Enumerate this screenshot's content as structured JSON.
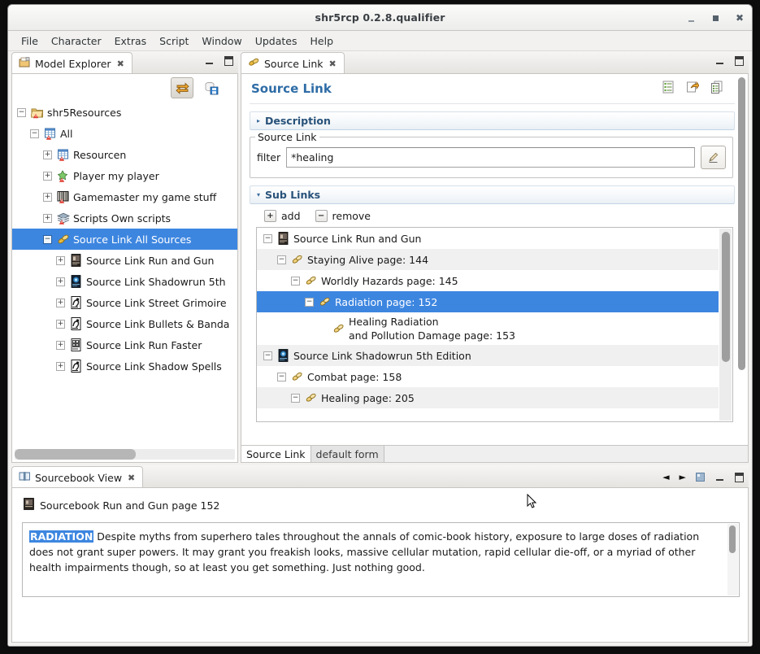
{
  "window": {
    "title": "shr5rcp 0.2.8.qualifier",
    "buttons": {
      "minimize": "minimize-icon",
      "maximize": "maximize-icon",
      "close": "close-icon"
    }
  },
  "menubar": {
    "items": [
      "File",
      "Character",
      "Extras",
      "Script",
      "Window",
      "Updates",
      "Help"
    ]
  },
  "model_explorer": {
    "tab_label": "Model Explorer",
    "tab_close": "✖",
    "toolbar": [
      {
        "name": "link-with-editor-icon",
        "pressed": true
      },
      {
        "name": "save-collapse-icon",
        "pressed": false
      }
    ],
    "tree": [
      {
        "label": "shr5Resources",
        "depth": 0,
        "expander": "−",
        "icon": "folder-warning-icon",
        "selected": false
      },
      {
        "label": "All",
        "depth": 1,
        "expander": "−",
        "icon": "table-warning-icon",
        "selected": false
      },
      {
        "label": "Resourcen",
        "depth": 2,
        "expander": "+",
        "icon": "table-warning-icon",
        "selected": false
      },
      {
        "label": "Player my player",
        "depth": 2,
        "expander": "+",
        "icon": "player-warning-icon",
        "selected": false
      },
      {
        "label": "Gamemaster my game stuff",
        "depth": 2,
        "expander": "+",
        "icon": "gamemaster-icon",
        "selected": false
      },
      {
        "label": "Scripts Own scripts",
        "depth": 2,
        "expander": "+",
        "icon": "scripts-warning-icon",
        "selected": false
      },
      {
        "label": "Source Link All Sources",
        "depth": 2,
        "expander": "−",
        "icon": "source-link-icon",
        "selected": true
      },
      {
        "label": "Source Link Run and Gun",
        "depth": 3,
        "expander": "+",
        "icon": "book-rag-icon",
        "selected": false
      },
      {
        "label": "Source Link Shadowrun 5th",
        "depth": 3,
        "expander": "+",
        "icon": "book-sr5-icon",
        "selected": false
      },
      {
        "label": "Source Link Street Grimoire",
        "depth": 3,
        "expander": "+",
        "icon": "book-sg-icon",
        "selected": false
      },
      {
        "label": "Source Link Bullets & Banda",
        "depth": 3,
        "expander": "+",
        "icon": "book-bb-icon",
        "selected": false
      },
      {
        "label": "Source Link Run Faster",
        "depth": 3,
        "expander": "+",
        "icon": "book-rf-icon",
        "selected": false
      },
      {
        "label": "Source Link Shadow Spells",
        "depth": 3,
        "expander": "+",
        "icon": "book-ss-icon",
        "selected": false
      }
    ]
  },
  "source_link_editor": {
    "tab_label": "Source Link",
    "tab_close": "✖",
    "form_title": "Source Link",
    "form_title_buttons": [
      "outline-icon",
      "export-icon",
      "copy-icon"
    ],
    "description_section": {
      "label": "Description",
      "twisty": "▸"
    },
    "group": {
      "legend": "Source Link",
      "filter_label": "filter",
      "filter_value": "*healing",
      "filter_placeholder": "",
      "edit_button": "edit-filter-icon"
    },
    "sub_links_section": {
      "label": "Sub Links",
      "twisty": "▾"
    },
    "actions": [
      {
        "label": "add",
        "glyph": "+",
        "name": "add-button"
      },
      {
        "label": "remove",
        "glyph": "−",
        "name": "remove-button"
      }
    ],
    "tree": [
      {
        "label": "Source Link Run and Gun",
        "depth": 0,
        "expander": "−",
        "icon": "book-rag-icon",
        "selected": false,
        "alt": false
      },
      {
        "label": "Staying Alive page: 144",
        "depth": 1,
        "expander": "−",
        "icon": "link-icon",
        "selected": false,
        "alt": true
      },
      {
        "label": "Worldly Hazards page: 145",
        "depth": 2,
        "expander": "−",
        "icon": "link-icon",
        "selected": false,
        "alt": false
      },
      {
        "label": "Radiation page: 152",
        "depth": 3,
        "expander": "−",
        "icon": "link-icon",
        "selected": true,
        "alt": false
      },
      {
        "label": "Healing Radiation\nand Pollution Damage page: 153",
        "depth": 4,
        "expander": "",
        "icon": "link-icon",
        "selected": false,
        "alt": false
      },
      {
        "label": "Source Link Shadowrun 5th Edition",
        "depth": 0,
        "expander": "−",
        "icon": "book-sr5-icon",
        "selected": false,
        "alt": true
      },
      {
        "label": "Combat page: 158",
        "depth": 1,
        "expander": "−",
        "icon": "link-icon",
        "selected": false,
        "alt": false
      },
      {
        "label": "Healing page: 205",
        "depth": 2,
        "expander": "−",
        "icon": "link-icon",
        "selected": false,
        "alt": true
      }
    ],
    "bottom_tabs": [
      {
        "label": "Source Link",
        "active": true
      },
      {
        "label": "default form",
        "active": false
      }
    ]
  },
  "sourcebook_view": {
    "tab_label": "Sourcebook View",
    "tab_close": "✖",
    "toolbar": [
      "back-arrow-icon",
      "forward-arrow-icon",
      "book-thumb-icon",
      "minimize-icon",
      "maximize-icon"
    ],
    "header_label": "Sourcebook Run and Gun page 152",
    "header_icon": "book-rag-icon",
    "text_highlight": "RADIATION",
    "text_body": " Despite myths from superhero tales throughout the annals of comic-book history, exposure to large doses of radiation does not grant super powers. It may grant you  freakish looks, massive cellular mutation, rapid cellular  die-off, or a myriad of other health impairments though,  so at least you get something. Just nothing good."
  },
  "colors": {
    "selection_blue": "#3d86e0",
    "form_title_blue": "#2e6ca6",
    "section_blue": "#28527a",
    "window_bg": "#f2f1f0"
  }
}
